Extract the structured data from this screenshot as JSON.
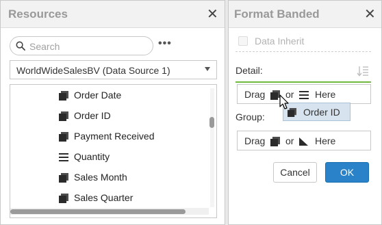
{
  "resources": {
    "title": "Resources",
    "search_placeholder": "Search",
    "data_source": "WorldWideSalesBV (Data Source 1)",
    "items": [
      {
        "label": "Order Date",
        "icon": "field-icon"
      },
      {
        "label": "Order ID",
        "icon": "field-icon"
      },
      {
        "label": "Payment Received",
        "icon": "field-icon"
      },
      {
        "label": "Quantity",
        "icon": "measure-icon"
      },
      {
        "label": "Sales Month",
        "icon": "field-icon"
      },
      {
        "label": "Sales Quarter",
        "icon": "field-icon"
      }
    ]
  },
  "format": {
    "title": "Format Banded",
    "inherit_label": "Data Inherit",
    "detail_label": "Detail:",
    "group_label": "Group:",
    "drag_word": "Drag",
    "or_word": "or",
    "here_word": "Here",
    "dragging_item": "Order ID",
    "cancel_label": "Cancel",
    "ok_label": "OK"
  },
  "colors": {
    "accent_green": "#6fb93c",
    "ok_blue": "#2a83c8",
    "title_gray": "#999999"
  }
}
